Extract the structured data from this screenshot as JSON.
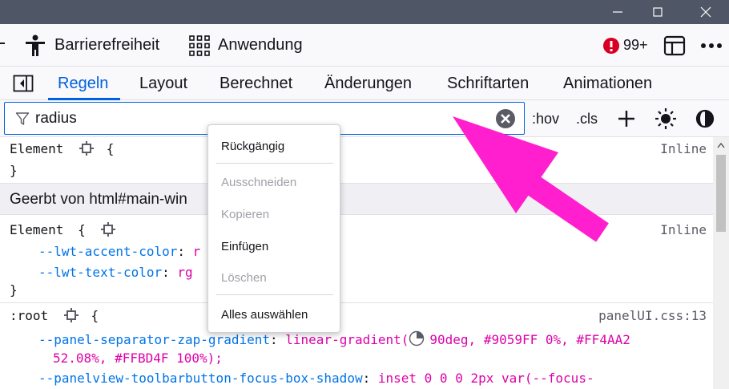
{
  "window": {
    "controls": [
      "minimize",
      "maximize",
      "close"
    ]
  },
  "toolbar": {
    "accessibility_label": "Barrierefreiheit",
    "application_label": "Anwendung",
    "error_count": "99+",
    "colors": {
      "error_badge": "#d70022"
    }
  },
  "tabs": [
    {
      "label": "Regeln",
      "active": true
    },
    {
      "label": "Layout"
    },
    {
      "label": "Berechnet"
    },
    {
      "label": "Änderungen"
    },
    {
      "label": "Schriftarten"
    },
    {
      "label": "Animationen"
    }
  ],
  "filter": {
    "value": "radius",
    "hov_label": ":hov",
    "cls_label": ".cls"
  },
  "rules": {
    "rule1": {
      "selector": "Element",
      "open": "{",
      "close": "}",
      "source": "Inline"
    },
    "inherited_header": "Geerbt von html#main-win",
    "rule2": {
      "selector": "Element",
      "open": "{",
      "close": "}",
      "source": "Inline",
      "decls": [
        {
          "prop": "--lwt-accent-color",
          "colon": ":",
          "value": "r"
        },
        {
          "prop": "--lwt-text-color",
          "colon": ":",
          "value": "rg"
        }
      ]
    },
    "rule3": {
      "selector": ":root",
      "open": "{",
      "source": "panelUI.css:13",
      "decl1_prop": "--panel-separator-zap-gradient",
      "decl1_colon": ":",
      "decl1_value_a": "linear-gradient(",
      "decl1_value_b": "90deg, #9059FF 0%, #FF4AA2",
      "decl1_value_c": "52.08%, #FFBD4F 100%);",
      "decl2_prop": "--panelview-toolbarbutton-focus-box-shadow",
      "decl2_colon": ":",
      "decl2_value": "inset 0 0 0 2px var(--focus-"
    }
  },
  "context_menu": {
    "undo": "Rückgängig",
    "cut": "Ausschneiden",
    "copy": "Kopieren",
    "paste": "Einfügen",
    "delete": "Löschen",
    "select_all": "Alles auswählen"
  },
  "colors": {
    "accent": "#0060df",
    "annotation_arrow": "#ff1fce"
  }
}
